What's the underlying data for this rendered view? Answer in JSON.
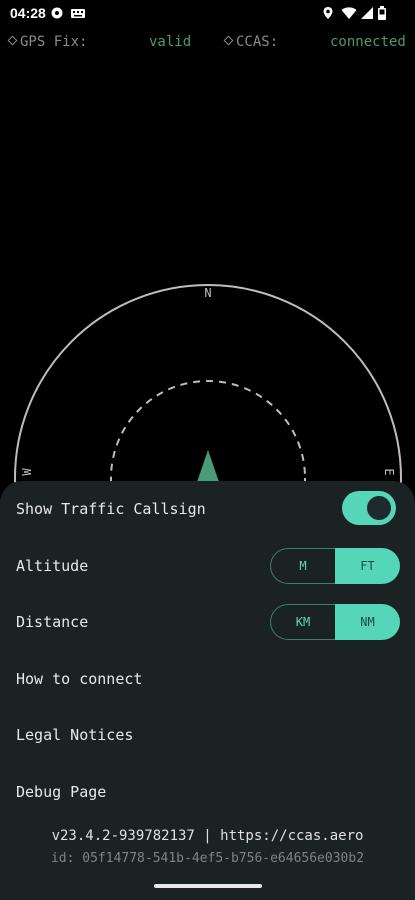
{
  "status_bar": {
    "time": "04:28",
    "icons": [
      "settings-gear-icon",
      "keyboard-icon",
      "location-pin-icon",
      "wifi-icon",
      "signal-icon",
      "battery-icon"
    ]
  },
  "info": {
    "gps_label": "GPS Fix:",
    "gps_value": "valid",
    "ccas_label": "CCAS:",
    "ccas_value": "connected"
  },
  "radar": {
    "north": "N",
    "west": "W",
    "east": "E"
  },
  "settings": {
    "show_callsign_label": "Show Traffic Callsign",
    "show_callsign_on": true,
    "altitude_label": "Altitude",
    "altitude_options": [
      "M",
      "FT"
    ],
    "altitude_selected": "FT",
    "distance_label": "Distance",
    "distance_options": [
      "KM",
      "NM"
    ],
    "distance_selected": "NM",
    "how_to_connect": "How to connect",
    "legal_notices": "Legal Notices",
    "debug_page": "Debug Page"
  },
  "footer": {
    "version": "v23.4.2-939782137 | https://ccas.aero",
    "device_id": "id: 05f14778-541b-4ef5-b756-e64656e030b2"
  },
  "colors": {
    "accent": "#55d6b8",
    "status_ok": "#4a9c6a",
    "sheet_bg": "#1a2224"
  }
}
